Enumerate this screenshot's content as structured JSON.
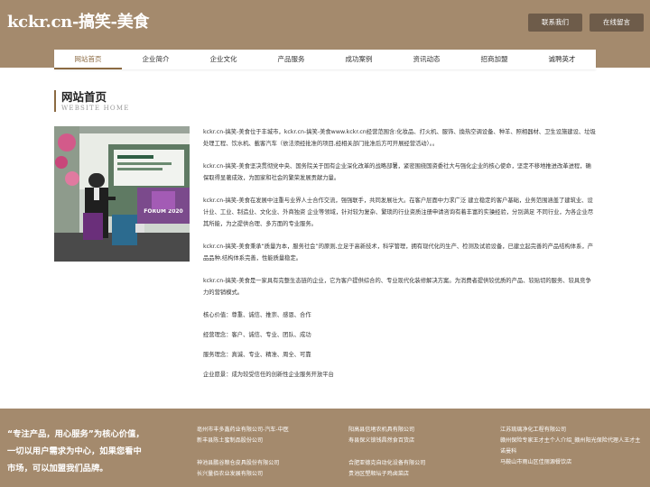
{
  "header": {
    "title": "kckr.cn-搞笑-美食",
    "contact_btn": "联系我们",
    "message_btn": "在线留言"
  },
  "nav": {
    "items": [
      "网站首页",
      "企业简介",
      "企业文化",
      "产品服务",
      "成功案例",
      "资讯动态",
      "招商加盟",
      "诚聘英才"
    ]
  },
  "section": {
    "title": "网站首页",
    "subtitle": "WEBSITE HOME"
  },
  "photo": {
    "banner_text": "FORUM 2020"
  },
  "content": {
    "paragraphs": [
      "kckr.cn-搞笑-美食位于丰城市，kckr.cn-搞笑-美食www.kckr.cn经营范围含:化妆品、打火机、服饰、換热空调设备、种羊、照相器材、卫生设施建设、垃圾处理工程、饮水机、載客汽车（依法须经批准的项目,经相关部门批准后方可开展经营活动）。。",
      "kckr.cn-搞笑-美食坚决贯彻党中央、国务院关于国有企业深化改革的战略部署，紧密围绕国资委社大与强化企业的核心使命，坚定不移地推进改革进程，确保取得显著成效，为国家和社会的繁荣发展贡献力量。",
      "kckr.cn-搞笑-美食在发展中注重与业界人士合作交流，强强联手，共同发展壮大。在客户层面中力求广泛 建立稳定的客户基础，业务范围涵盖了建筑业、设计业、工业、制造业、文化业、外商独资 企业等领域，针对较为复杂、繁琐的行业资质注册申请咨询有着丰富的实操经验，分别满足 不同行业，为各企业尽其所能，为之提供合理、多方面的专业服务。",
      "kckr.cn-搞笑-美食秉承“质量为本，服务社会”的原则,立足于高新技术，科学管理，拥有现代化的生产、检测及试验设备，已建立起完善的产品结构体系，产品品种,结构体系完善，性能质量稳定。",
      "kckr.cn-搞笑-美食是一家具有完整生态链的企业，它为客户提供综合的、专业现代化装修解决方案。为消费者提供较优质的产品、较贴切的服务、较具竞争力的营销模式。"
    ],
    "values": [
      "核心价值：尊重、诚信、推崇、感恩、合作",
      "经营理念：客户、诚信、专业、团队、成功",
      "服务理念：真诚、专业、精准、周全、可靠",
      "企业愿景：成为较受信任的创新性企业服务开放平台"
    ]
  },
  "footer": {
    "slogan": "“专注产品，用心服务”为核心价值，一切以用户需求为中心，如果您看中市场，可以加盟我们品牌。",
    "col1": {
      "group1": [
        "亳州市丰多鑫药业有限公司-汽车-中医",
        "新丰县陈土蜜制品股份公司"
      ],
      "group2": [
        "神池县鹏谷粮仓皮具股份有限公司",
        "长兴量佰农业发展有限公司"
      ]
    },
    "col2": {
      "group1": [
        "阳高县信堵农机具有限公司",
        "寿县保义锁钱昌然食百货店"
      ],
      "group2": [
        "合肥亚德克自动化设备有限公司",
        "贵池区塑顺坛子鸡卤菜店"
      ]
    },
    "col3": {
      "group1": [
        "江苏琉璃净化工程有限公司",
        "赣州保险专家王才主个人介绍_赣州阳光保险代理人王才主"
      ],
      "group2": [
        "诺曼科",
        "马鞍山市雨山区佳丽源餐饮店"
      ]
    }
  },
  "colors": {
    "header_bg": "#a48a6d",
    "button_bg": "#6e5c4a",
    "accent": "#8b6a42"
  }
}
